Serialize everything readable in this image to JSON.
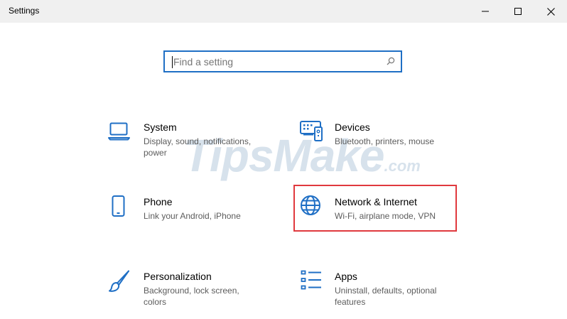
{
  "window": {
    "title": "Settings"
  },
  "search": {
    "placeholder": "Find a setting"
  },
  "tiles": [
    {
      "title": "System",
      "description": "Display, sound, notifications, power",
      "icon": "laptop-icon"
    },
    {
      "title": "Devices",
      "description": "Bluetooth, printers, mouse",
      "icon": "keyboard-icon"
    },
    {
      "title": "Phone",
      "description": "Link your Android, iPhone",
      "icon": "phone-icon"
    },
    {
      "title": "Network & Internet",
      "description": "Wi-Fi, airplane mode, VPN",
      "icon": "globe-icon"
    },
    {
      "title": "Personalization",
      "description": "Background, lock screen, colors",
      "icon": "paintbrush-icon"
    },
    {
      "title": "Apps",
      "description": "Uninstall, defaults, optional features",
      "icon": "app-list-icon"
    }
  ],
  "watermark": {
    "main": "TipsMake",
    "suffix": ".com"
  },
  "colors": {
    "accent": "#1f6fc5",
    "highlight": "#e0393e",
    "titlebar": "#f0f0f0",
    "description_text": "#5c5c5c"
  }
}
